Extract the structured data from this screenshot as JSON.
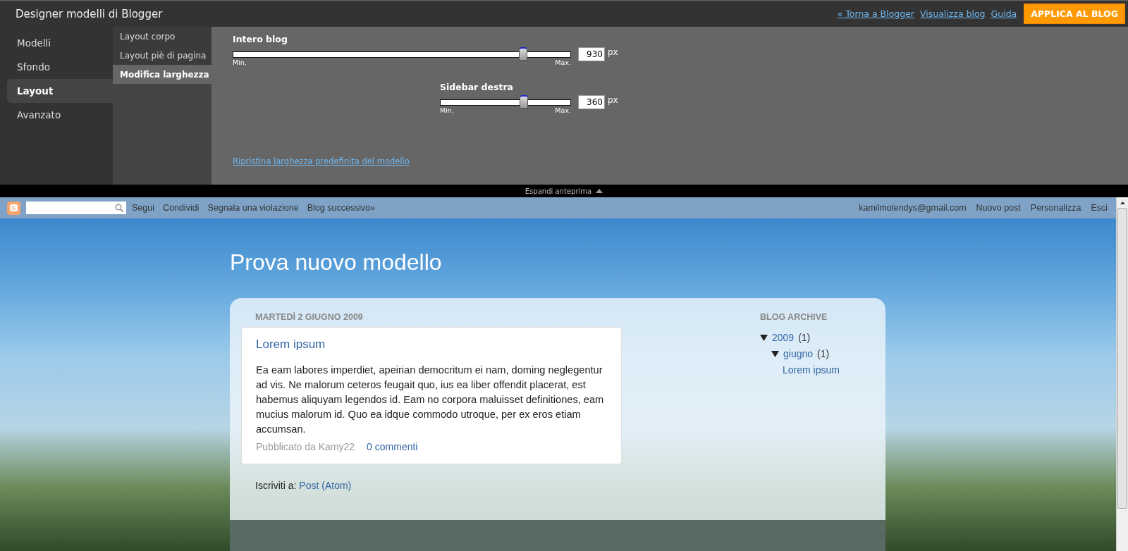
{
  "app_bar": {
    "title": "Designer modelli di Blogger",
    "links": [
      "« Torna a Blogger",
      "Visualizza blog",
      "Guida"
    ],
    "apply_button": "APPLICA AL BLOG"
  },
  "nav": [
    {
      "label": "Modelli",
      "selected": false
    },
    {
      "label": "Sfondo",
      "selected": false
    },
    {
      "label": "Layout",
      "selected": true
    },
    {
      "label": "Avanzato",
      "selected": false
    }
  ],
  "subnav": [
    {
      "label": "Layout corpo",
      "selected": false
    },
    {
      "label": "Layout piè di pagina",
      "selected": false
    },
    {
      "label": "Modifica larghezza",
      "selected": true
    }
  ],
  "sliders": [
    {
      "label": "Intero blog",
      "value": "930",
      "unit": "px",
      "min_label": "Min.",
      "max_label": "Max.",
      "level": 0.86
    },
    {
      "label": "Sidebar destra",
      "value": "360",
      "unit": "px",
      "min_label": "Min.",
      "max_label": "Max.",
      "level": 0.64
    }
  ],
  "reset_link": "Ripristina larghezza predefinita del modello",
  "preview_toggle": "Espandi anteprima",
  "navbar": {
    "links": [
      "Segui",
      "Condividi",
      "Segnala una violazione",
      "Blog successivo»"
    ],
    "user_links": [
      "kamilmolendys@gmail.com",
      "Nuovo post",
      "Personalizza",
      "Esci"
    ]
  },
  "blog": {
    "title": "Prova nuovo modello",
    "date": "MARTEDÌ 2 GIUGNO 2009",
    "post": {
      "title": "Lorem ipsum",
      "body": "Ea eam labores imperdiet, apeirian democritum ei nam, doming neglegentur ad vis. Ne malorum ceteros feugait quo, ius ea liber offendit placerat, est habemus aliquyam legendos id. Eam no corpora maluisset definitiones, eam mucius malorum id. Quo ea idque commodo utroque, per ex eros etiam accumsan.",
      "author": "Pubblicato da Kamy22",
      "comments": "0 commenti"
    },
    "subscribe_label": "Iscriviti a:",
    "subscribe_link": "Post (Atom)",
    "archive": {
      "title": "BLOG ARCHIVE",
      "tree": [
        {
          "label": "2009",
          "count": "(1)",
          "expanded": true,
          "children": [
            {
              "label": "giugno",
              "count": "(1)",
              "expanded": true,
              "children": [
                {
                  "label": "Lorem ipsum"
                }
              ]
            }
          ]
        }
      ]
    }
  }
}
